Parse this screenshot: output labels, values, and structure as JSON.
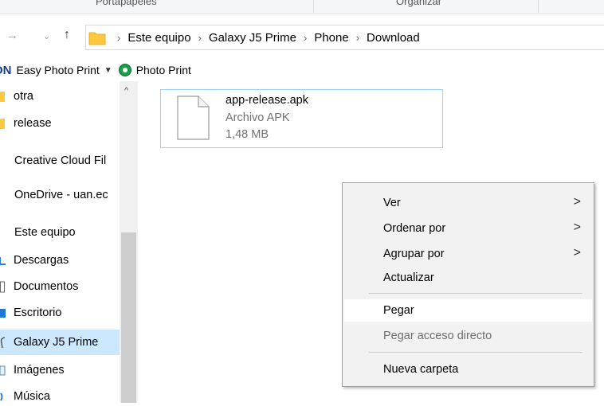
{
  "ribbon": {
    "groups": [
      "Portapapeles",
      "Organizar"
    ]
  },
  "address_bar": {
    "crumbs": [
      "Este equipo",
      "Galaxy J5 Prime",
      "Phone",
      "Download"
    ]
  },
  "toolbar": {
    "brand": "ON",
    "easy_photo_print": "Easy Photo Print",
    "photo_print": "Photo Print"
  },
  "sidebar": {
    "items": [
      {
        "label": "otra"
      },
      {
        "label": "release"
      },
      {
        "label": "Creative Cloud Fil"
      },
      {
        "label": "OneDrive - uan.ec"
      },
      {
        "label": "Este equipo"
      },
      {
        "label": "Descargas"
      },
      {
        "label": "Documentos"
      },
      {
        "label": "Escritorio"
      },
      {
        "label": "Galaxy J5 Prime"
      },
      {
        "label": "Imágenes"
      },
      {
        "label": "Música"
      }
    ]
  },
  "file": {
    "name": "app-release.apk",
    "type": "Archivo APK",
    "size": "1,48 MB"
  },
  "context_menu": {
    "items": [
      {
        "label": "Ver"
      },
      {
        "label": "Ordenar por"
      },
      {
        "label": "Agrupar por"
      },
      {
        "label": "Actualizar"
      },
      {
        "label": "Pegar"
      },
      {
        "label": "Pegar acceso directo"
      },
      {
        "label": "Nueva carpeta"
      }
    ]
  },
  "colors": {
    "selection": "#cce8ff",
    "tile_border": "#99d1ff",
    "folder": "#ffc83d",
    "brand": "#1a3c8c"
  }
}
